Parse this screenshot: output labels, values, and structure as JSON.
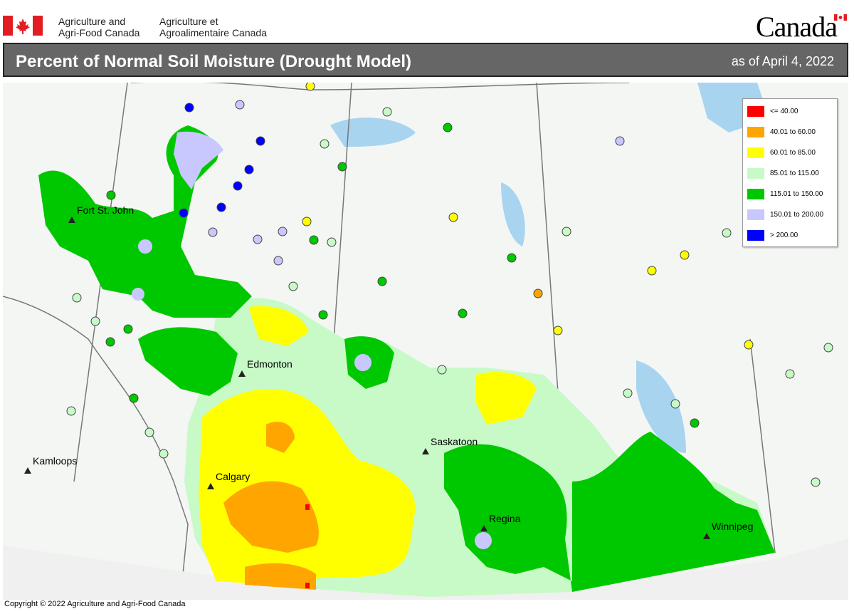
{
  "header": {
    "dept_en_line1": "Agriculture and",
    "dept_en_line2": "Agri-Food Canada",
    "dept_fr_line1": "Agriculture et",
    "dept_fr_line2": "Agroalimentaire Canada",
    "wordmark": "Canada"
  },
  "title": "Percent of Normal Soil Moisture (Drought Model)",
  "as_of": "as of April 4, 2022",
  "legend": [
    {
      "label": "<= 40.00",
      "color": "#ff0000"
    },
    {
      "label": "40.01  to  60.00",
      "color": "#ffa500"
    },
    {
      "label": "60.01  to  85.00",
      "color": "#ffff00"
    },
    {
      "label": "85.01  to  115.00",
      "color": "#c8fac8"
    },
    {
      "label": "115.01  to  150.00",
      "color": "#00c800"
    },
    {
      "label": "150.01  to  200.00",
      "color": "#c8c8ff"
    },
    {
      "label": "> 200.00",
      "color": "#0000ff"
    }
  ],
  "cities": {
    "fort_st_john": "Fort St. John",
    "edmonton": "Edmonton",
    "kamloops": "Kamloops",
    "calgary": "Calgary",
    "saskatoon": "Saskatoon",
    "regina": "Regina",
    "winnipeg": "Winnipeg"
  },
  "copyright": "Copyright © 2022 Agriculture and Agri-Food Canada"
}
